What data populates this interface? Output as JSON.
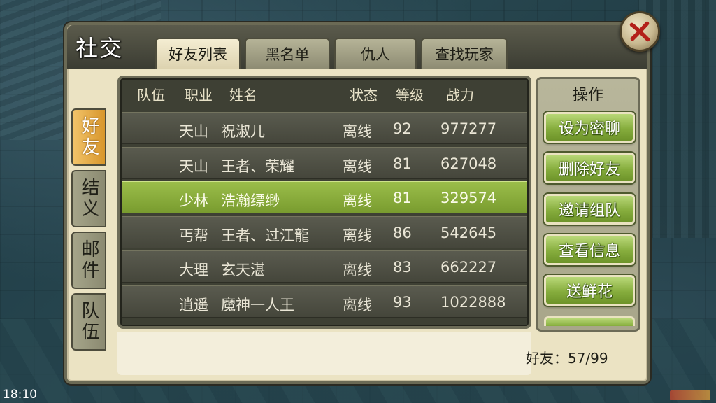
{
  "window": {
    "title": "社交"
  },
  "tabs": [
    {
      "label": "好友列表",
      "active": true
    },
    {
      "label": "黑名单",
      "active": false
    },
    {
      "label": "仇人",
      "active": false
    },
    {
      "label": "查找玩家",
      "active": false
    }
  ],
  "side_tabs": [
    {
      "label": "好友",
      "active": true
    },
    {
      "label": "结义",
      "active": false
    },
    {
      "label": "邮件",
      "active": false
    },
    {
      "label": "队伍",
      "active": false
    }
  ],
  "table": {
    "columns": [
      "队伍",
      "职业",
      "姓名",
      "状态",
      "等级",
      "战力"
    ],
    "rows": [
      {
        "job": "天山",
        "name": "祝淑儿",
        "status": "离线",
        "level": "92",
        "power": "977277",
        "selected": false
      },
      {
        "job": "天山",
        "name": "王者、荣耀",
        "status": "离线",
        "level": "81",
        "power": "627048",
        "selected": false
      },
      {
        "job": "少林",
        "name": "浩瀚缥缈",
        "status": "离线",
        "level": "81",
        "power": "329574",
        "selected": true
      },
      {
        "job": "丐帮",
        "name": "王者、过江龍",
        "status": "离线",
        "level": "86",
        "power": "542645",
        "selected": false
      },
      {
        "job": "大理",
        "name": "玄天湛",
        "status": "离线",
        "level": "83",
        "power": "662227",
        "selected": false
      },
      {
        "job": "逍遥",
        "name": "魔神一人王",
        "status": "离线",
        "level": "93",
        "power": "1022888",
        "selected": false
      }
    ]
  },
  "operations": {
    "title": "操作",
    "buttons": [
      "设为密聊",
      "删除好友",
      "邀请组队",
      "查看信息",
      "送鲜花"
    ]
  },
  "footer": {
    "friend_count": "好友：57/99"
  },
  "status_bar": {
    "clock": "18:10"
  },
  "icons": {
    "close": "close-x-icon"
  },
  "colors": {
    "selected_row": "#8aae3c",
    "active_side_tab": "#e2a23e",
    "op_button": "#86ad3d"
  }
}
